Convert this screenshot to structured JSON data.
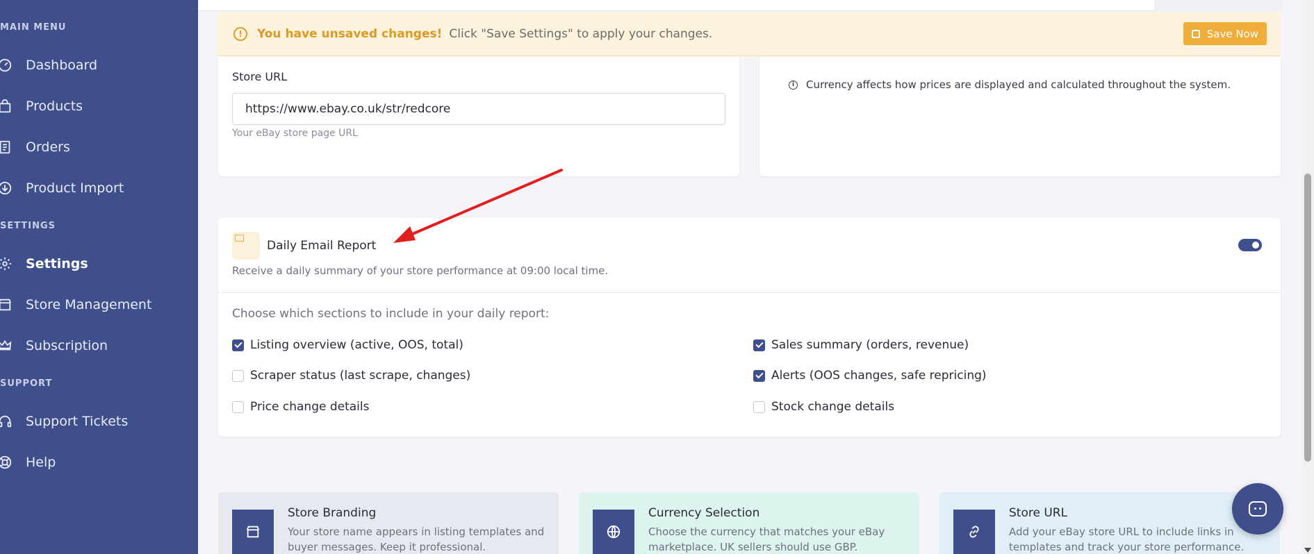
{
  "sidebar": {
    "sections": {
      "main": "MAIN MENU",
      "settings": "SETTINGS",
      "support": "SUPPORT"
    },
    "items": [
      {
        "label": "Dashboard",
        "icon": "dashboard-icon"
      },
      {
        "label": "Products",
        "icon": "bag-icon"
      },
      {
        "label": "Orders",
        "icon": "receipt-icon"
      },
      {
        "label": "Product Import",
        "icon": "cloud-download-icon"
      },
      {
        "label": "Settings",
        "icon": "gear-icon",
        "active": true
      },
      {
        "label": "Store Management",
        "icon": "store-icon"
      },
      {
        "label": "Subscription",
        "icon": "crown-icon"
      },
      {
        "label": "Support Tickets",
        "icon": "headset-icon"
      },
      {
        "label": "Help",
        "icon": "lifebuoy-icon"
      }
    ]
  },
  "banner": {
    "title": "You have unsaved changes!",
    "text": "Click \"Save Settings\" to apply your changes.",
    "save_label": "Save Now"
  },
  "store_url": {
    "label": "Store URL",
    "value": "https://www.ebay.co.uk/str/redcore",
    "hint": "Your eBay store page URL"
  },
  "currency": {
    "info": "Currency affects how prices are displayed and calculated throughout the system."
  },
  "daily_report": {
    "title": "Daily Email Report",
    "subtitle": "Receive a daily summary of your store performance at 09:00 local time.",
    "enabled": true,
    "choose_label": "Choose which sections to include in your daily report:",
    "options": [
      {
        "label": "Listing overview (active, OOS, total)",
        "checked": true
      },
      {
        "label": "Sales summary (orders, revenue)",
        "checked": true
      },
      {
        "label": "Scraper status (last scrape, changes)",
        "checked": false
      },
      {
        "label": "Alerts (OOS changes, safe repricing)",
        "checked": true
      },
      {
        "label": "Price change details",
        "checked": false
      },
      {
        "label": "Stock change details",
        "checked": false
      }
    ]
  },
  "tiles": [
    {
      "title": "Store Branding",
      "text": "Your store name appears in listing templates and buyer messages. Keep it professional.",
      "icon": "store-icon"
    },
    {
      "title": "Currency Selection",
      "text": "Choose the currency that matches your eBay marketplace. UK sellers should use GBP.",
      "icon": "globe-icon"
    },
    {
      "title": "Store URL",
      "text": "Add your eBay store URL to include links in templates and track your store performance.",
      "icon": "link-icon"
    }
  ],
  "colors": {
    "sidebar_bg": "#3f4f8c",
    "accent": "#3f4f8c",
    "warning": "#f0ad3a",
    "annotation_arrow": "#e02020"
  }
}
